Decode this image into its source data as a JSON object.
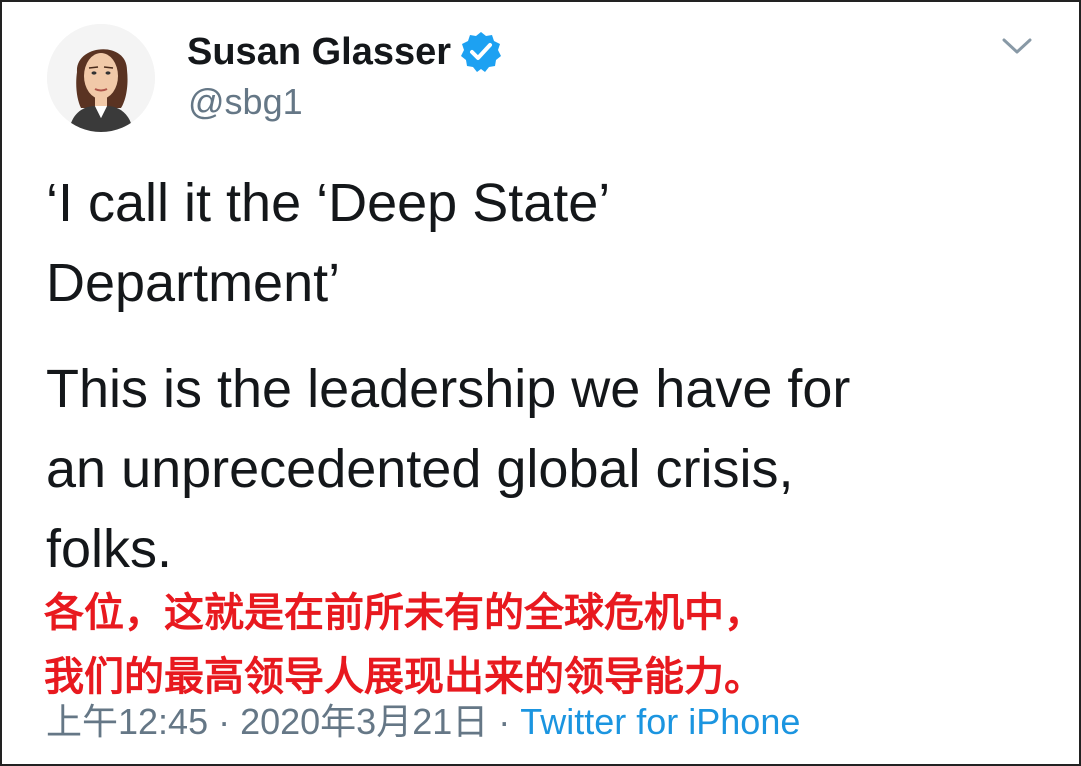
{
  "tweet": {
    "author": {
      "display_name": "Susan Glasser",
      "handle": "@sbg1",
      "verified_icon": "verified-badge-icon",
      "avatar_icon": "avatar-illustration"
    },
    "menu_icon": "chevron-down-icon",
    "text_lines_paragraph_1": [
      "‘I call it the ‘Deep State’",
      "Department’"
    ],
    "text_lines_paragraph_2": [
      "This is the leadership we have for",
      "an unprecedented global crisis,",
      "folks."
    ],
    "timestamp": "上午12:45",
    "separator": "·",
    "date": "2020年3月21日",
    "source": "Twitter for iPhone"
  },
  "overlay_caption": {
    "line1": "各位，这就是在前所未有的全球危机中，",
    "line2": "我们的最高领导人展现出来的领导能力。",
    "color": "#e8191f"
  },
  "colors": {
    "text": "#14171a",
    "secondary": "#657786",
    "link": "#1b95e0",
    "verified": "#1da1f2"
  }
}
